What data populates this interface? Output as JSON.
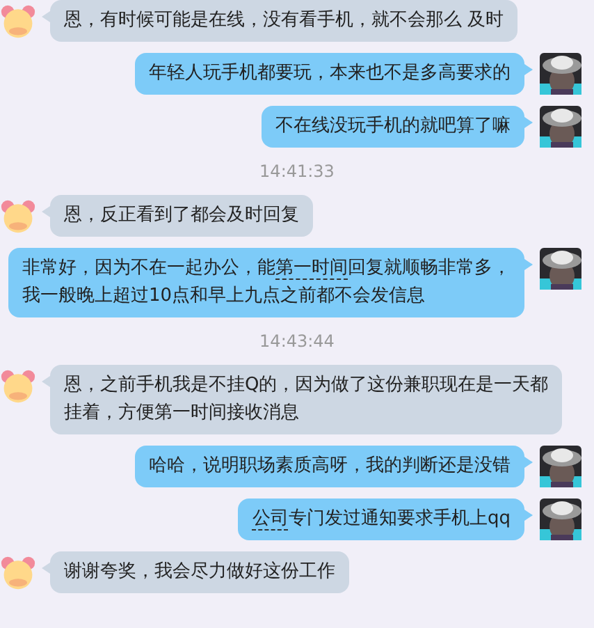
{
  "messages": [
    {
      "kind": "incoming",
      "lines": [
        [
          {
            "text": "恩，有时候可能是在线，没有看手机，就不会那么 及时",
            "underlined": false
          }
        ]
      ]
    },
    {
      "kind": "outgoing",
      "lines": [
        [
          {
            "text": "年轻人玩手机都要玩，本来也不是多高要求的",
            "underlined": false
          }
        ]
      ]
    },
    {
      "kind": "outgoing",
      "lines": [
        [
          {
            "text": "不在线没玩手机的就吧算了嘛",
            "underlined": false
          }
        ]
      ]
    },
    {
      "kind": "time",
      "text": "14:41:33"
    },
    {
      "kind": "incoming",
      "lines": [
        [
          {
            "text": "恩，反正看到了都会及时回复",
            "underlined": false
          }
        ]
      ]
    },
    {
      "kind": "outgoing",
      "lines": [
        [
          {
            "text": "非常好，因为不在一起办公，能",
            "underlined": false
          },
          {
            "text": "第一时间",
            "underlined": true
          },
          {
            "text": "回复就顺畅非常多，",
            "underlined": false
          }
        ],
        [
          {
            "text": "我一般晚上超过10点和早上九点之前都不会发信息",
            "underlined": false
          }
        ]
      ]
    },
    {
      "kind": "time",
      "text": "14:43:44"
    },
    {
      "kind": "incoming",
      "lines": [
        [
          {
            "text": "恩，之前手机我是不挂Q的，因为做了这份兼职现在是一天都",
            "underlined": false
          }
        ],
        [
          {
            "text": "挂着，方便第一时间接收消息",
            "underlined": false
          }
        ]
      ]
    },
    {
      "kind": "outgoing",
      "lines": [
        [
          {
            "text": "哈哈，说明职场素质高呀，我的判断还是没错",
            "underlined": false
          }
        ]
      ]
    },
    {
      "kind": "outgoing",
      "lines": [
        [
          {
            "text": "公司",
            "underlined": true
          },
          {
            "text": "专门发过通知要求手机上qq",
            "underlined": false
          }
        ]
      ]
    },
    {
      "kind": "incoming",
      "lines": [
        [
          {
            "text": "谢谢夸奖，我会尽力做好这份工作",
            "underlined": false
          }
        ]
      ]
    }
  ]
}
